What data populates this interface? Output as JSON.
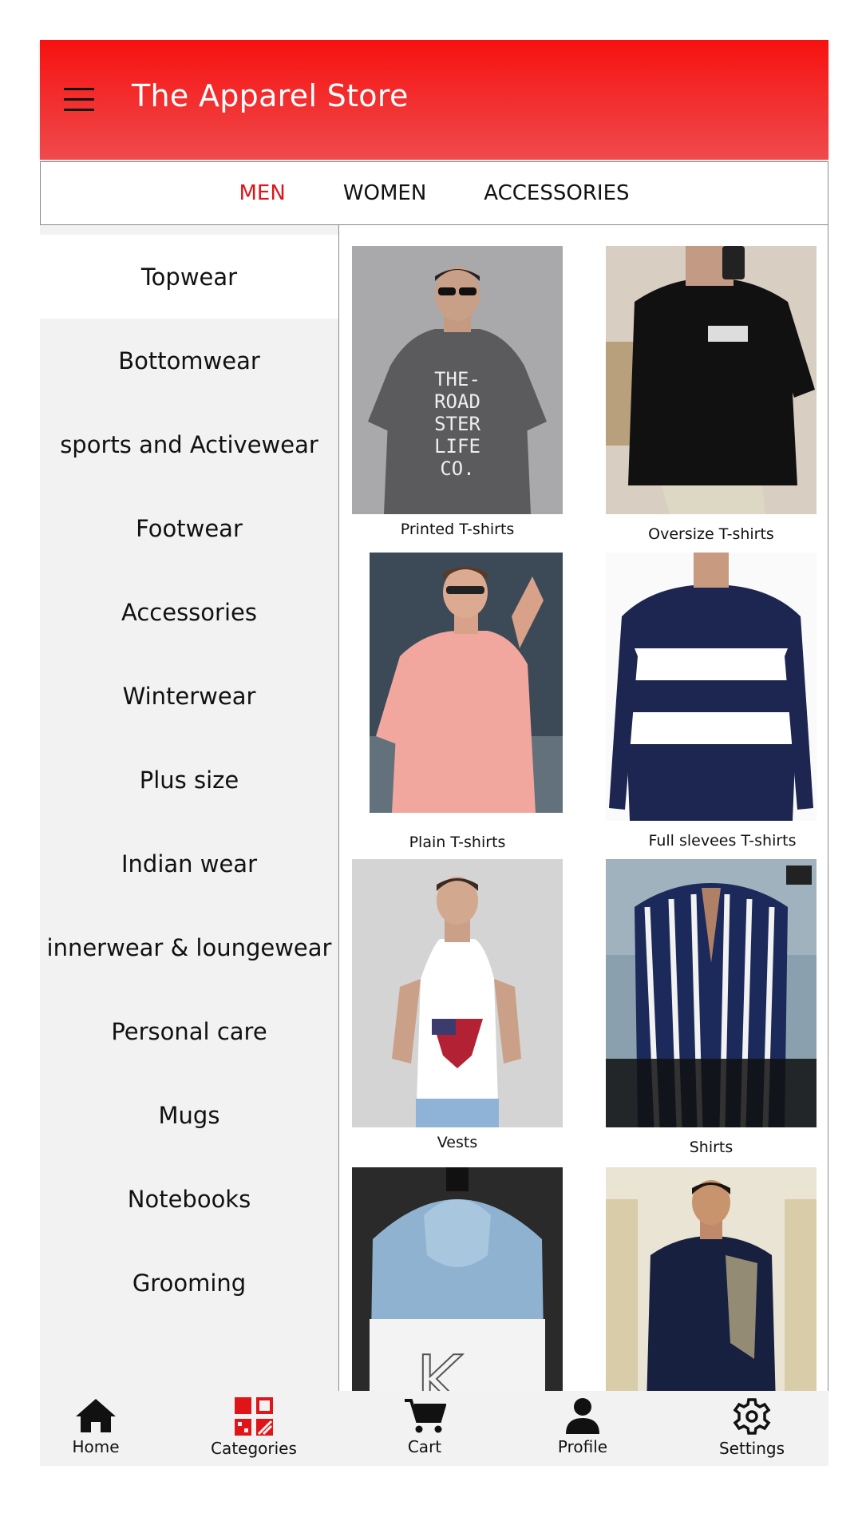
{
  "header": {
    "title": "The Apparel Store",
    "menu_icon": "hamburger-menu-icon"
  },
  "tabs": [
    {
      "label": "MEN",
      "active": true
    },
    {
      "label": "WOMEN",
      "active": false
    },
    {
      "label": "ACCESSORIES",
      "active": false
    }
  ],
  "sidebar": {
    "items": [
      {
        "label": "Topwear",
        "active": true
      },
      {
        "label": "Bottomwear"
      },
      {
        "label": "sports and Activewear"
      },
      {
        "label": "Footwear"
      },
      {
        "label": "Accessories"
      },
      {
        "label": "Winterwear"
      },
      {
        "label": "Plus size"
      },
      {
        "label": "Indian wear"
      },
      {
        "label": "innerwear & loungewear"
      },
      {
        "label": "Personal care"
      },
      {
        "label": "Mugs"
      },
      {
        "label": "Notebooks"
      },
      {
        "label": "Grooming"
      }
    ]
  },
  "products": [
    {
      "name": "Printed T-shirts"
    },
    {
      "name": "Oversize T-shirts"
    },
    {
      "name": "Plain T-shirts"
    },
    {
      "name": "Full slevees T-shirts"
    },
    {
      "name": "Vests"
    },
    {
      "name": "Shirts"
    },
    {
      "name": ""
    },
    {
      "name": ""
    }
  ],
  "bottom_nav": [
    {
      "label": "Home",
      "icon": "home-icon"
    },
    {
      "label": "Categories",
      "icon": "categories-icon",
      "active": true
    },
    {
      "label": "Cart",
      "icon": "cart-icon"
    },
    {
      "label": "Profile",
      "icon": "profile-icon"
    },
    {
      "label": "Settings",
      "icon": "settings-icon"
    }
  ],
  "colors": {
    "accent": "#e0151a",
    "header_top": "#f7110f",
    "header_bottom": "#ef4a4d",
    "sidebar_bg": "#f2f2f2"
  }
}
